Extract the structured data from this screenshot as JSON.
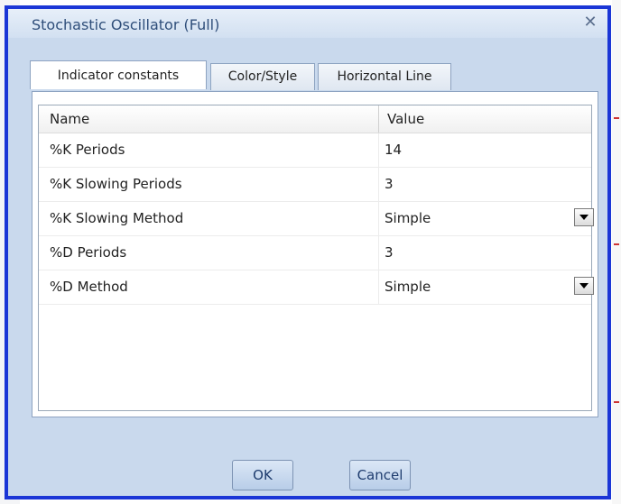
{
  "dialog": {
    "title": "Stochastic Oscillator (Full)",
    "close_symbol": "✕"
  },
  "tabs": [
    {
      "label": "Indicator constants",
      "active": true
    },
    {
      "label": "Color/Style",
      "active": false
    },
    {
      "label": "Horizontal Line",
      "active": false
    }
  ],
  "grid": {
    "headers": {
      "name": "Name",
      "value": "Value"
    },
    "rows": [
      {
        "name": "%K Periods",
        "value": "14",
        "has_dropdown": false
      },
      {
        "name": "%K Slowing Periods",
        "value": "3",
        "has_dropdown": false
      },
      {
        "name": "%K Slowing Method",
        "value": "Simple",
        "has_dropdown": true
      },
      {
        "name": "%D Periods",
        "value": "3",
        "has_dropdown": false
      },
      {
        "name": "%D Method",
        "value": "Simple",
        "has_dropdown": true
      }
    ]
  },
  "buttons": {
    "ok_label": "OK",
    "cancel_label": "Cancel"
  },
  "colors": {
    "dialog_border": "#1b36d6",
    "dialog_bg": "#c9d9ed",
    "title_text": "#2f4e7a"
  },
  "icons": {
    "close": "close-icon",
    "dropdown": "chevron-down-icon"
  }
}
